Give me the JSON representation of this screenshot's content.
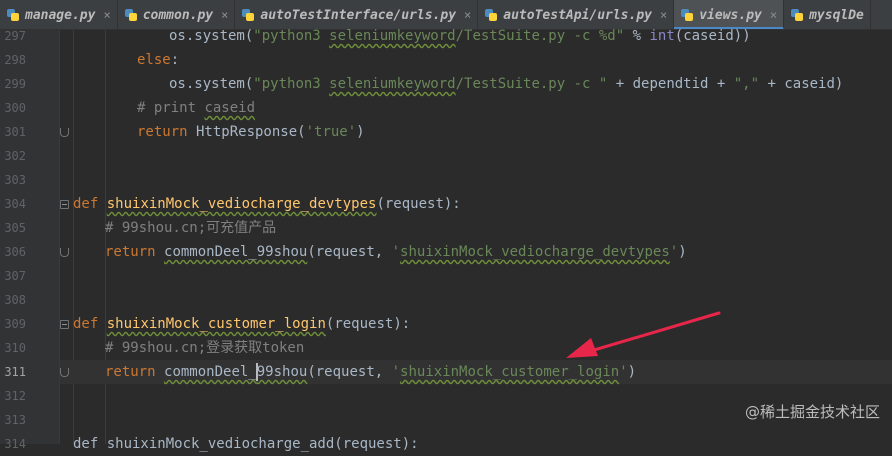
{
  "tabs": [
    {
      "label": "manage.py",
      "active": false
    },
    {
      "label": "common.py",
      "active": false
    },
    {
      "label": "autoTestInterface/urls.py",
      "active": false
    },
    {
      "label": "autoTestApi/urls.py",
      "active": false
    },
    {
      "label": "views.py",
      "active": true
    },
    {
      "label": "mysqlDe",
      "active": false
    }
  ],
  "line_numbers": [
    "297",
    "298",
    "299",
    "300",
    "301",
    "302",
    "303",
    "304",
    "305",
    "306",
    "307",
    "308",
    "309",
    "310",
    "311",
    "312",
    "313",
    "314"
  ],
  "current_line": "311",
  "code": {
    "l297": {
      "a": "os.system(",
      "b": "\"python3 ",
      "c": "seleniumkeyword",
      "d": "/TestSuite.py -c %d\"",
      "e": " % ",
      "f": "int",
      "g": "(caseid))"
    },
    "l298": {
      "a": "else",
      "b": ":"
    },
    "l299": {
      "a": "os.system(",
      "b": "\"python3 ",
      "c": "seleniumkeyword",
      "d": "/TestSuite.py -c \"",
      "e": " + dependtid + ",
      "f": "\",\"",
      "g": " + caseid)"
    },
    "l300": {
      "a": "# print ",
      "b": "caseid"
    },
    "l301": {
      "a": "return",
      "b": " HttpResponse(",
      "c": "'true'",
      "d": ")"
    },
    "l304": {
      "a": "def",
      "b": " ",
      "c": "shuixinMock_vediocharge_devtypes",
      "d": "(request):"
    },
    "l305": {
      "a": "# 99shou.cn;可充值产品"
    },
    "l306": {
      "a": "return",
      "b": " ",
      "c": "commonDeel_99shou",
      "d": "(request, ",
      "e": "'",
      "f": "shuixinMock_vediocharge_devtypes",
      "g": "'",
      "h": ")"
    },
    "l309": {
      "a": "def",
      "b": " ",
      "c": "shuixinMock_customer_login",
      "d": "(request):"
    },
    "l310": {
      "a": "# 99shou.cn;登录获取token"
    },
    "l311": {
      "a": "return",
      "b": " ",
      "c": "commonDeel_",
      "d": "99shou",
      "e": "(request, ",
      "f": "'",
      "g": "shuixinMock_customer_login",
      "h": "'",
      "i": ")"
    },
    "l314": {
      "a": "def shuixinMock_vediocharge_add(request):"
    }
  },
  "watermark": "@稀土掘金技术社区",
  "colors": {
    "background": "#2b2b2b",
    "gutter": "#313335",
    "keyword": "#cc7832",
    "function": "#ffc66d",
    "string": "#6a8759",
    "comment": "#808080",
    "builtin": "#8888c6",
    "arrow": "#e8264a"
  },
  "icons": {
    "file_tab": "python-file-icon",
    "annotation": "red-arrow-annotation"
  }
}
